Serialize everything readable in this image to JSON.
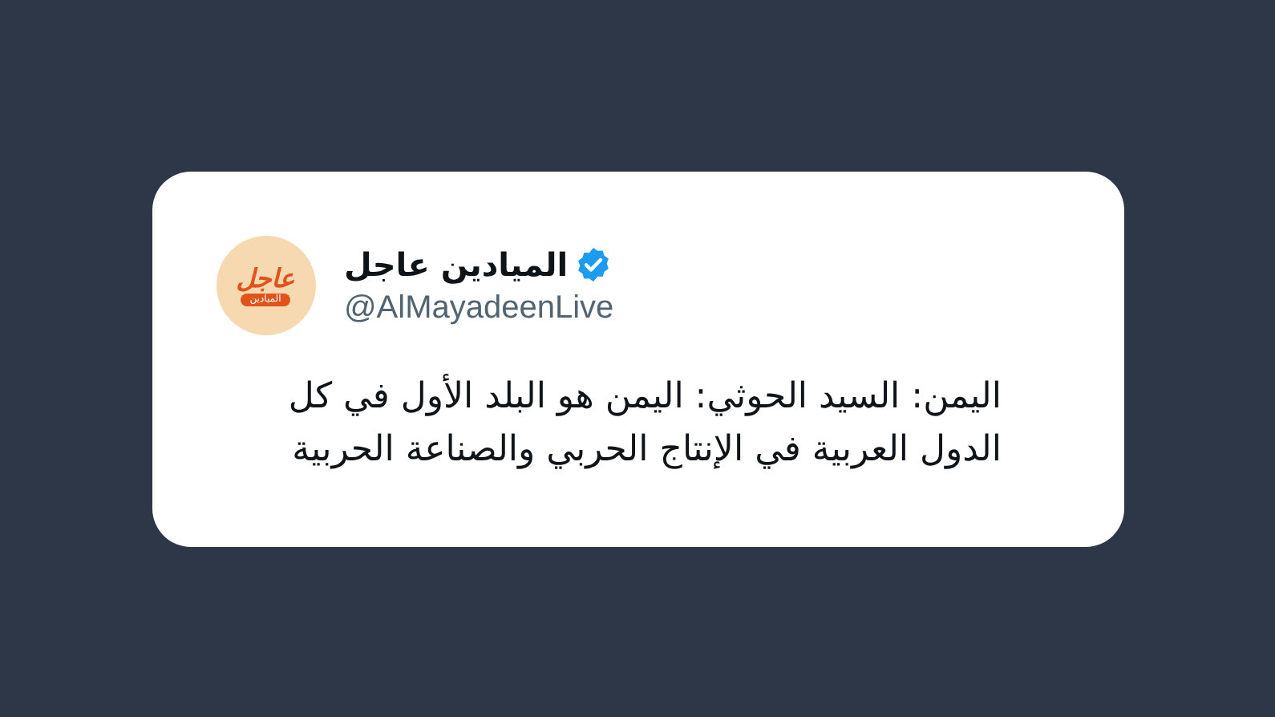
{
  "tweet": {
    "author": {
      "name": "الميادين عاجل",
      "verified": true,
      "handle": "@AlMayadeenLive",
      "avatar_logo": {
        "top": "عاجل",
        "bottom": "الميادين"
      }
    },
    "text": "اليمن: السيد الحوثي: اليمن هو البلد الأول في كل الدول العربية في الإنتاج الحربي والصناعة الحربية"
  }
}
